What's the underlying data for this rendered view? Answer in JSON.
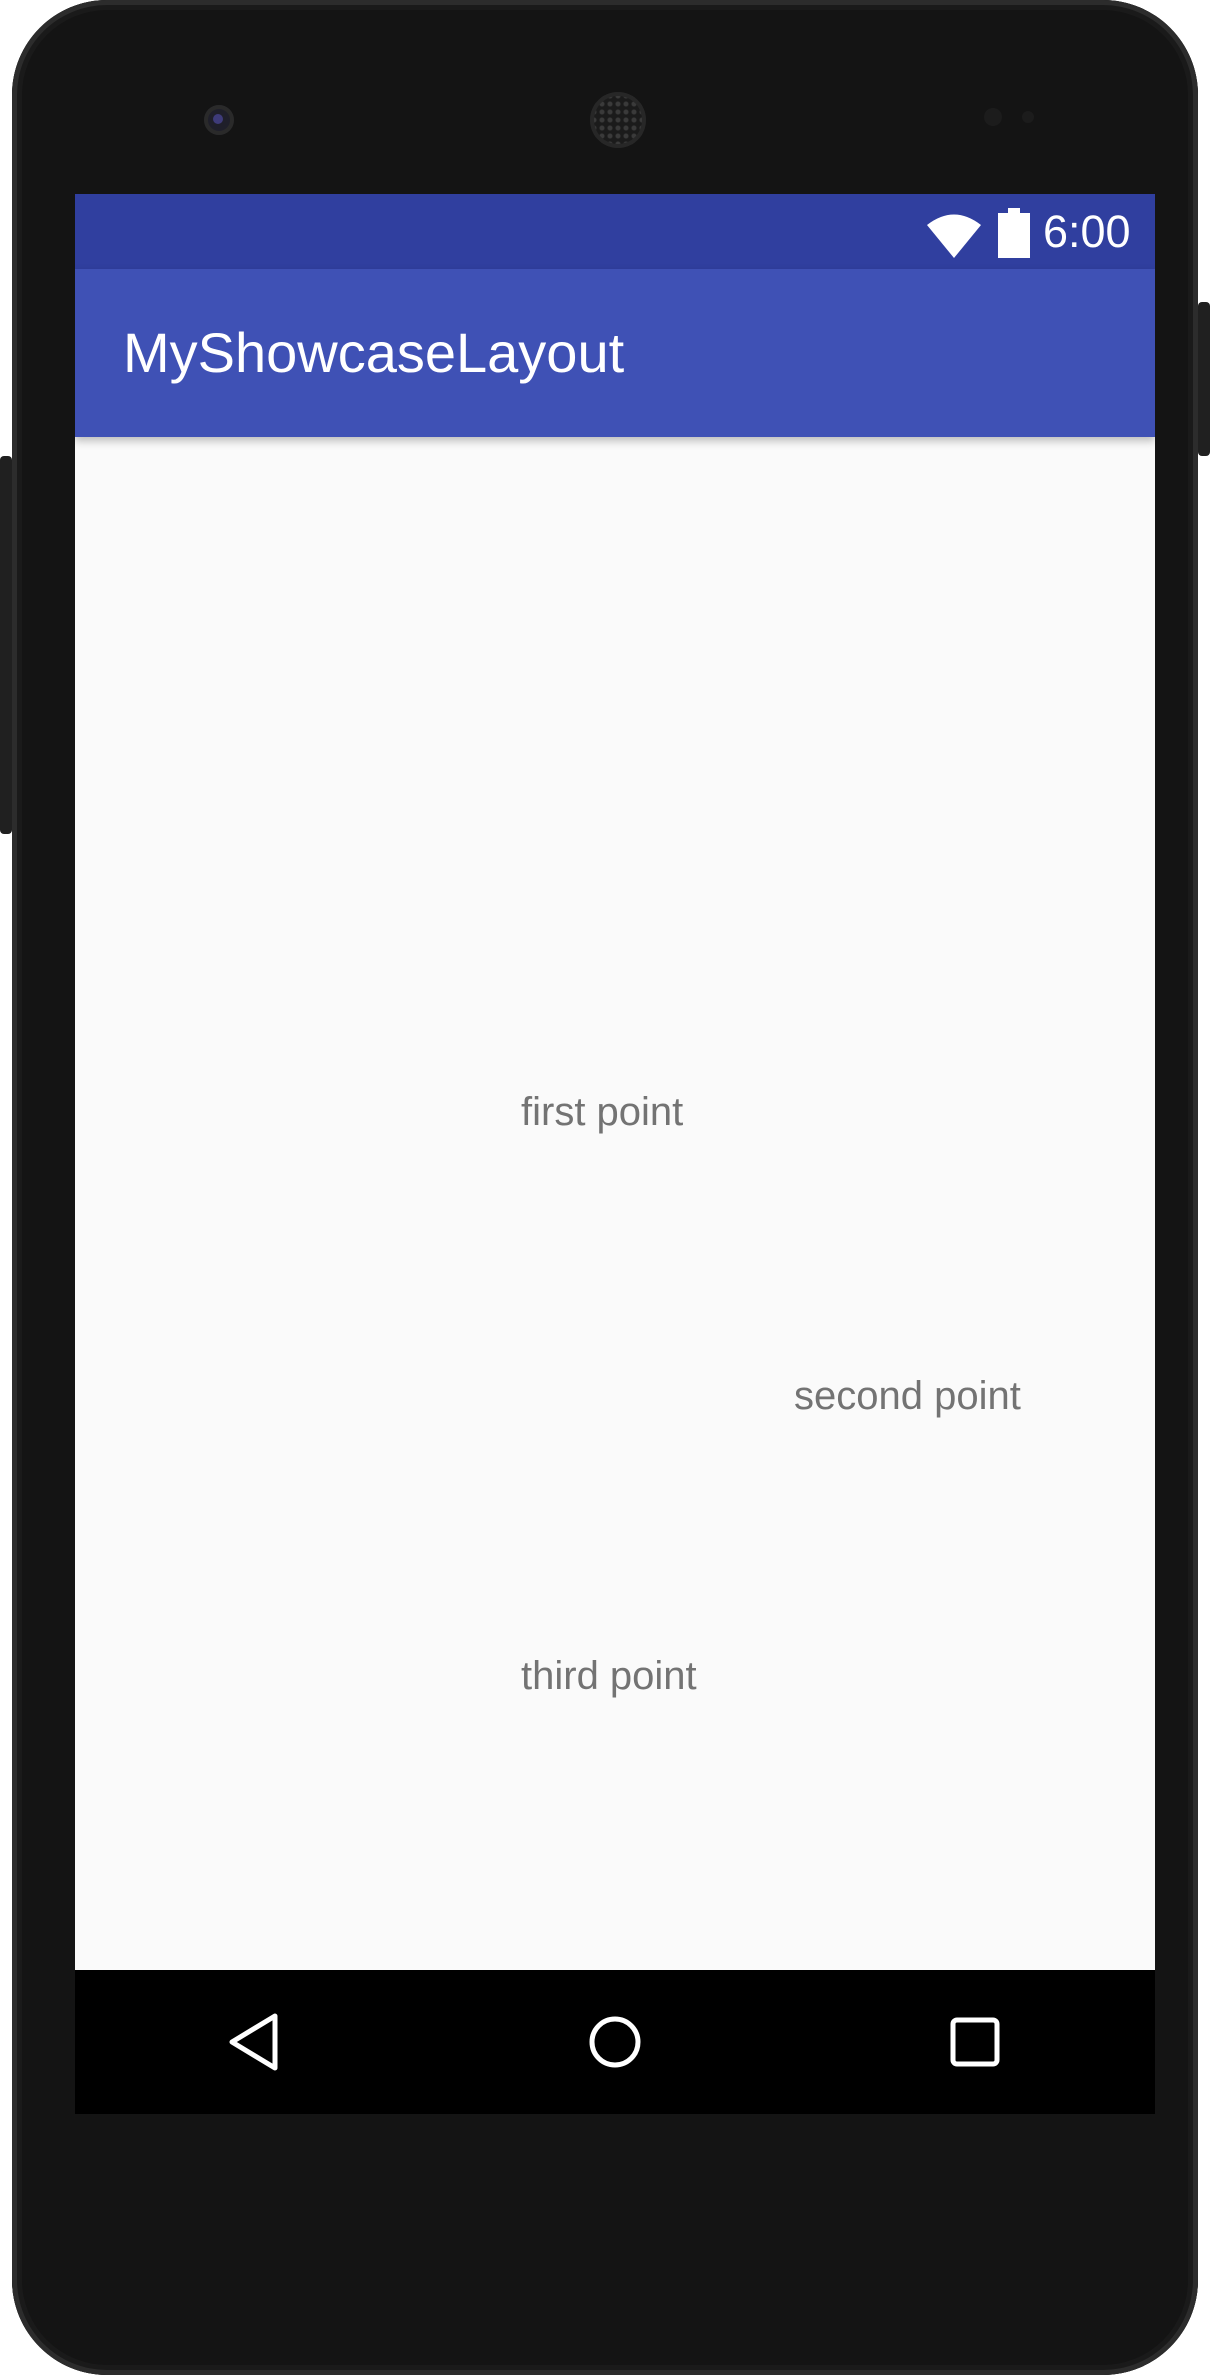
{
  "status_bar": {
    "time": "6:00",
    "icons": [
      "wifi-icon",
      "battery-icon"
    ],
    "color": "#303f9f"
  },
  "app_bar": {
    "title": "MyShowcaseLayout",
    "color": "#3f51b5"
  },
  "content": {
    "points": [
      {
        "label": "first point"
      },
      {
        "label": "second point"
      },
      {
        "label": "third point"
      }
    ],
    "background": "#fafafa",
    "text_color": "#737373"
  },
  "nav_bar": {
    "buttons": [
      "back-icon",
      "home-icon",
      "recents-icon"
    ],
    "color": "#000000"
  }
}
